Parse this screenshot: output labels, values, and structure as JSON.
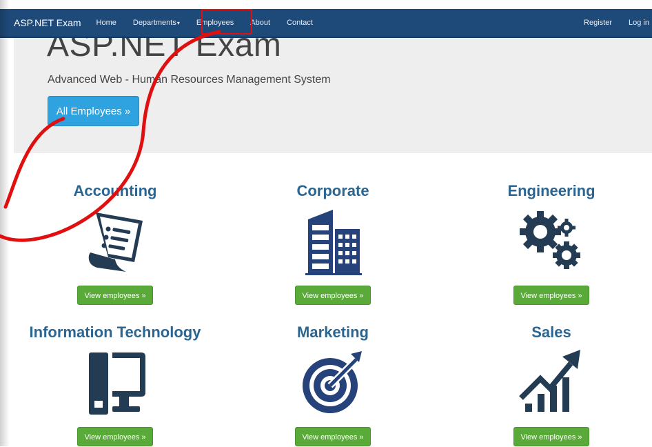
{
  "navbar": {
    "brand": "ASP.NET Exam",
    "links": [
      {
        "label": "Home"
      },
      {
        "label": "Departments",
        "dropdown": true
      },
      {
        "label": "Employees",
        "highlighted": true
      },
      {
        "label": "About"
      },
      {
        "label": "Contact"
      }
    ],
    "right_links": [
      {
        "label": "Register"
      },
      {
        "label": "Log in"
      }
    ],
    "caret_glyph": "▾"
  },
  "jumbotron": {
    "title": "ASP.NET Exam",
    "subtitle": "Advanced Web - Human Resources Management System",
    "button_label": "All Employees »"
  },
  "departments": [
    {
      "name": "Accounting",
      "icon": "invoice-icon",
      "button": "View employees »"
    },
    {
      "name": "Corporate",
      "icon": "building-icon",
      "button": "View employees »"
    },
    {
      "name": "Engineering",
      "icon": "gears-icon",
      "button": "View employees »"
    },
    {
      "name": "Information Technology",
      "icon": "computer-icon",
      "button": "View employees »"
    },
    {
      "name": "Marketing",
      "icon": "target-icon",
      "button": "View employees »"
    },
    {
      "name": "Sales",
      "icon": "growth-chart-icon",
      "button": "View employees »"
    }
  ],
  "colors": {
    "navbar": "#1e4a7a",
    "heading": "#2b6591",
    "primary_button": "#2ea3e0",
    "success_button": "#5aaa3a",
    "annotation": "#e01010",
    "icon_dark": "#243b54",
    "icon_blue": "#25427a"
  }
}
